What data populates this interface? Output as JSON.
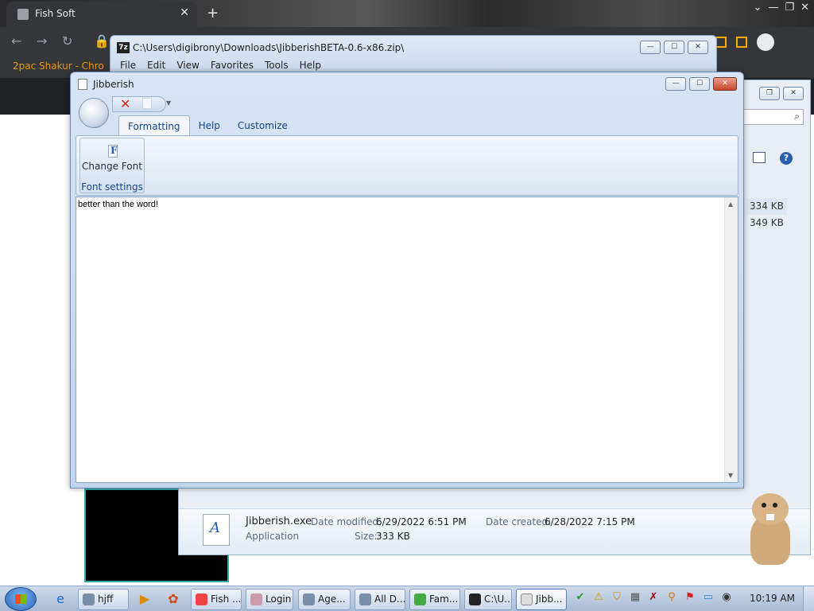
{
  "browser": {
    "tab_title": "Fish Soft",
    "tab_close": "✕",
    "new_tab": "+",
    "bookmark": "2pac Shakur - Chro"
  },
  "sevenzip": {
    "icon_text": "7z",
    "title": "C:\\Users\\digibrony\\Downloads\\JibberishBETA-0.6-x86.zip\\",
    "menu": [
      "File",
      "Edit",
      "View",
      "Favorites",
      "Tools",
      "Help"
    ]
  },
  "explorer": {
    "sizes": [
      "334 KB",
      "349 KB"
    ],
    "details": {
      "name": "Jibberish.exe",
      "type": "Application",
      "modified_label": "Date modified:",
      "modified_value": "6/29/2022 6:51 PM",
      "created_label": "Date created:",
      "created_value": "6/28/2022 7:15 PM",
      "size_label": "Size:",
      "size_value": "333 KB"
    }
  },
  "jibberish": {
    "title": "Jibberish",
    "tabs": [
      "Formatting",
      "Help",
      "Customize"
    ],
    "active_tab": "Formatting",
    "change_font_label": "Change Font",
    "group_label": "Font settings",
    "editor_text": "better than the word!"
  },
  "taskbar": {
    "items": [
      {
        "label": "hjff"
      },
      {
        "label": "Fish ..."
      },
      {
        "label": "Login"
      },
      {
        "label": "Age..."
      },
      {
        "label": "All D..."
      },
      {
        "label": "Fam..."
      },
      {
        "label": "C:\\U..."
      },
      {
        "label": "Jibb..."
      }
    ],
    "clock": "10:19 AM"
  }
}
